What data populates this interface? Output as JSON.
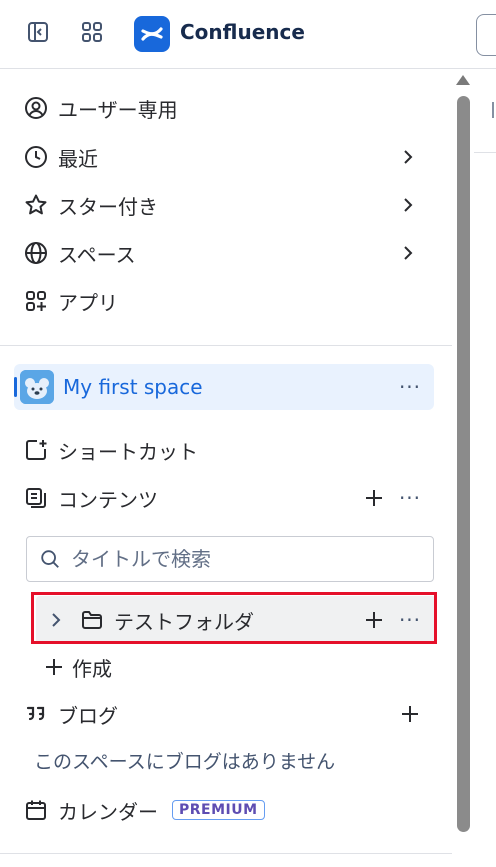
{
  "topbar": {
    "app_name": "Confluence",
    "icons": [
      "sidebar-toggle-icon",
      "app-switcher-icon",
      "confluence-logo"
    ]
  },
  "nav": {
    "for_you": "ユーザー専用",
    "recent": "最近",
    "starred": "スター付き",
    "spaces": "スペース",
    "apps": "アプリ"
  },
  "space": {
    "name": "My first space",
    "more": "···",
    "shortcuts": "ショートカット",
    "content": "コンテンツ",
    "content_more": "···",
    "search_placeholder": "タイトルで検索",
    "folder": {
      "label": "テストフォルダ",
      "more": "···"
    },
    "create": "作成",
    "blog": "ブログ",
    "blog_empty": "このスペースにブログはありません",
    "calendar": "カレンダー",
    "calendar_badge": "PREMIUM"
  },
  "colors": {
    "accent": "#1868db",
    "selected_bg": "#e9f2fe",
    "highlight_border": "#e5102a",
    "premium_text": "#5e4db2"
  }
}
